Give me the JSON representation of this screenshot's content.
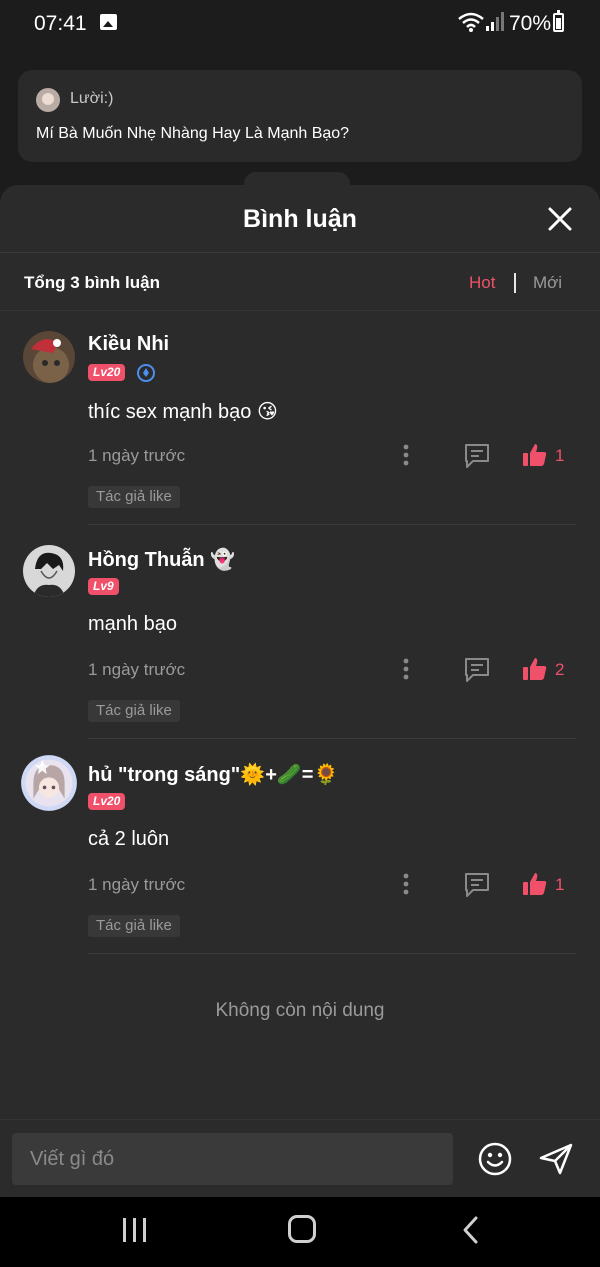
{
  "status_bar": {
    "time": "07:41",
    "battery": "70%"
  },
  "background_post": {
    "author": "Lười:)",
    "text": "Mí Bà Muốn Nhẹ Nhàng Hay Là Mạnh Bạo?"
  },
  "sheet": {
    "title": "Bình luận",
    "total": "Tổng 3 bình luận",
    "sort_hot": "Hot",
    "sort_new": "Mới",
    "end_text": "Không còn nội dung"
  },
  "comments": [
    {
      "name": "Kiều Nhi",
      "level": "Lv20",
      "text": "thíc sex mạnh bạo 😘",
      "time": "1 ngày trước",
      "likes": "1",
      "author_like": "Tác giả like"
    },
    {
      "name": "Hồng Thuẫn 👻",
      "level": "Lv9",
      "text": "mạnh bạo",
      "time": "1 ngày trước",
      "likes": "2",
      "author_like": "Tác giả like"
    },
    {
      "name": "hủ \"trong sáng\"🌞+🥒=🌻",
      "level": "Lv20",
      "text": "cả 2 luôn",
      "time": "1 ngày trước",
      "likes": "1",
      "author_like": "Tác giả like"
    }
  ],
  "input": {
    "placeholder": "Viết gì đó"
  },
  "colors": {
    "accent": "#f0506a",
    "sheet_bg": "#2b2b2b",
    "muted": "#9a9a9a"
  },
  "icons": [
    "wifi-icon",
    "signal-icon",
    "battery-icon",
    "close-icon",
    "more-icon",
    "reply-icon",
    "like-icon",
    "emoji-icon",
    "send-icon"
  ]
}
